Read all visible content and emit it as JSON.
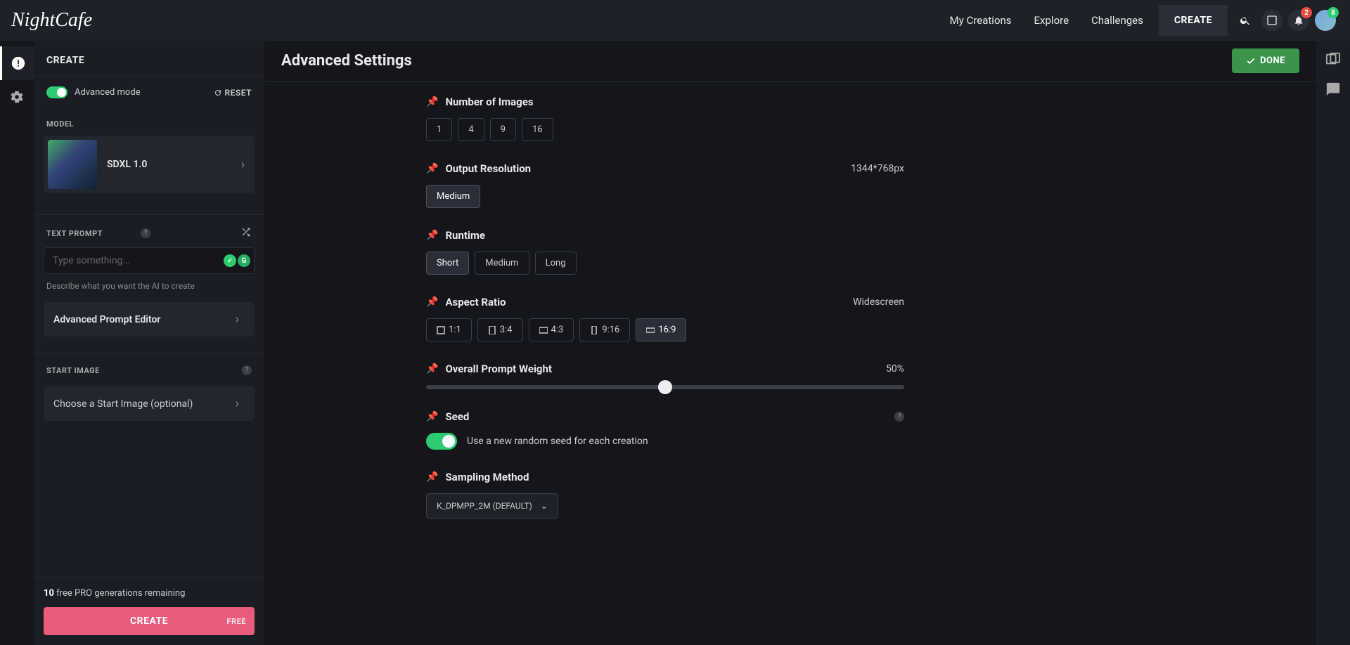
{
  "topbar": {
    "logo": "NightCafe",
    "nav": {
      "my_creations": "My Creations",
      "explore": "Explore",
      "challenges": "Challenges"
    },
    "create": "CREATE",
    "notif_count": "2",
    "avatar_count": "8"
  },
  "sidebar": {
    "create_header": "CREATE",
    "advanced_mode": "Advanced mode",
    "reset": "RESET",
    "model_label": "MODEL",
    "model_name": "SDXL 1.0",
    "text_prompt_label": "TEXT PROMPT",
    "prompt_placeholder": "Type something...",
    "prompt_hint": "Describe what you want the AI to create",
    "advanced_editor": "Advanced Prompt Editor",
    "start_image_label": "START IMAGE",
    "start_image_hint": "Choose a Start Image (optional)",
    "credits_count": "10",
    "credits_text": " free PRO generations remaining",
    "create_btn": "CREATE",
    "free_tag": "FREE"
  },
  "content": {
    "title": "Advanced Settings",
    "done": "DONE",
    "number_of_images": {
      "title": "Number of Images",
      "options": [
        "1",
        "4",
        "9",
        "16"
      ]
    },
    "output_resolution": {
      "title": "Output Resolution",
      "value": "1344*768px",
      "option": "Medium"
    },
    "runtime": {
      "title": "Runtime",
      "options": [
        "Short",
        "Medium",
        "Long"
      ],
      "active": "Short"
    },
    "aspect_ratio": {
      "title": "Aspect Ratio",
      "value": "Widescreen",
      "options": [
        "1:1",
        "3:4",
        "4:3",
        "9:16",
        "16:9"
      ],
      "active": "16:9"
    },
    "prompt_weight": {
      "title": "Overall Prompt Weight",
      "value": "50%"
    },
    "seed": {
      "title": "Seed",
      "label": "Use a new random seed for each creation"
    },
    "sampling": {
      "title": "Sampling Method",
      "value": "K_DPMPP_2M (DEFAULT)"
    }
  }
}
